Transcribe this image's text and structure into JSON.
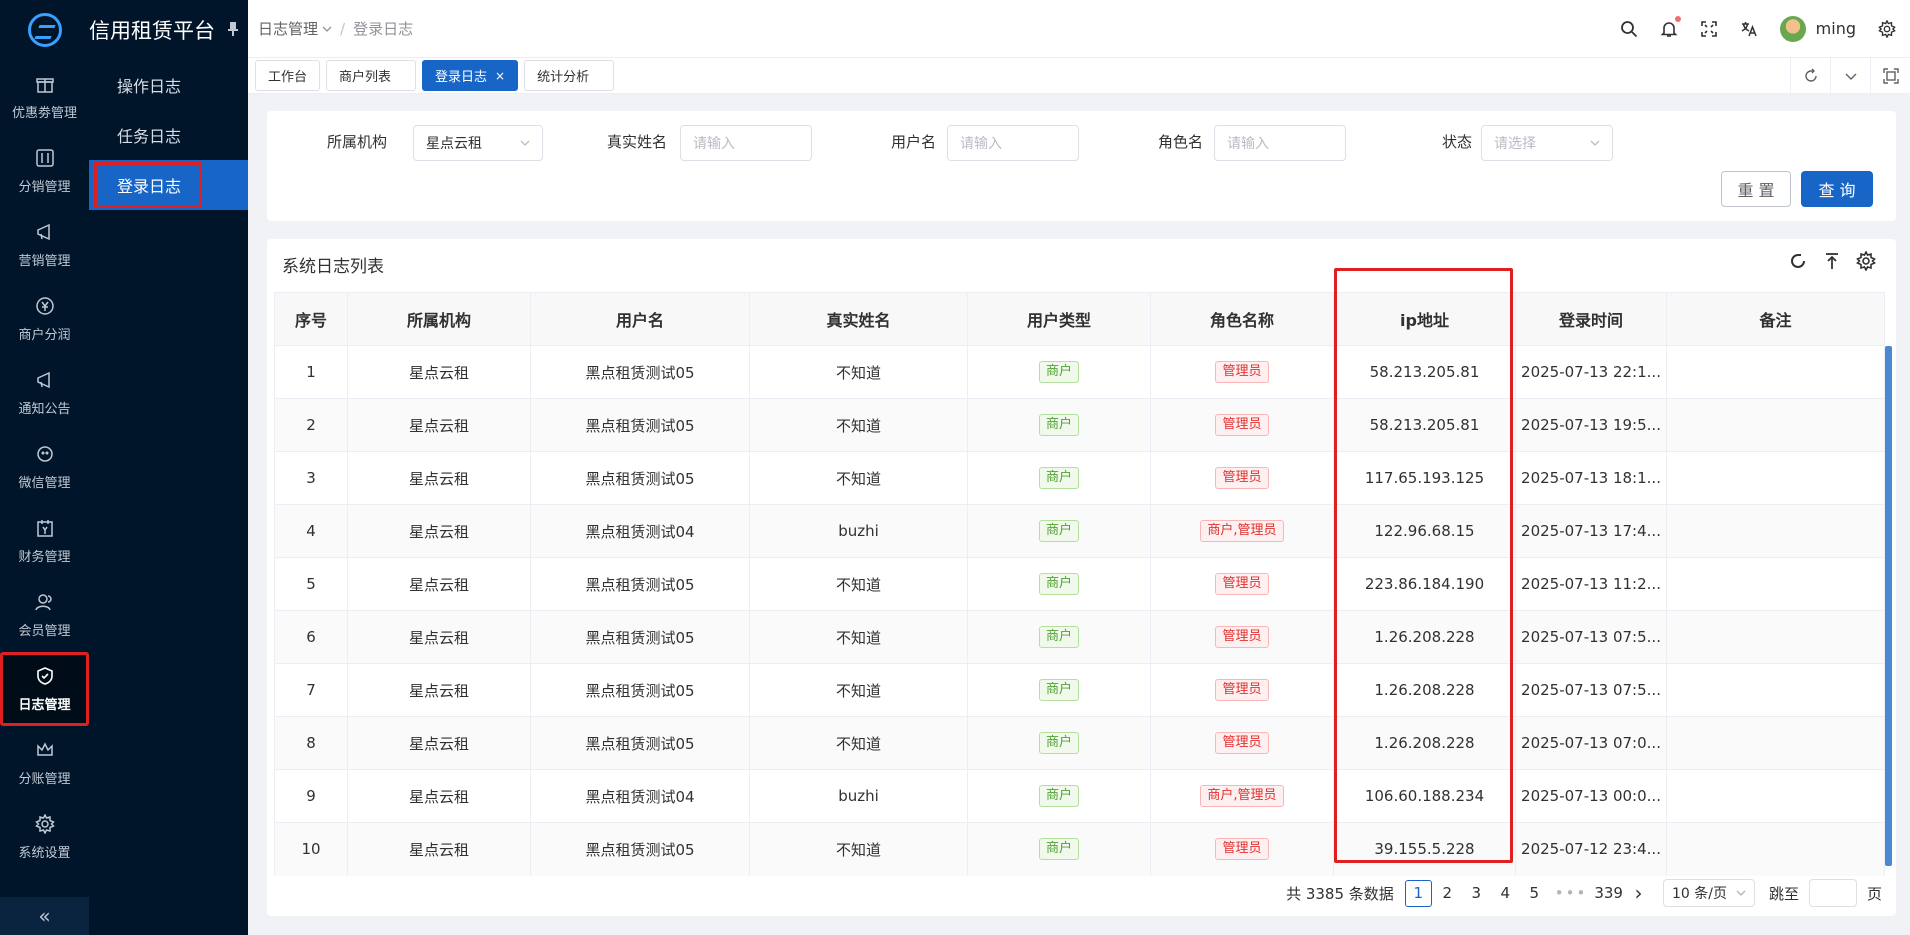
{
  "app": {
    "title": "信用租赁平台"
  },
  "rail": {
    "items": [
      {
        "label": "优惠劵管理",
        "icon": "gift-icon"
      },
      {
        "label": "分销管理",
        "icon": "sliders-icon"
      },
      {
        "label": "营销管理",
        "icon": "megaphone-icon"
      },
      {
        "label": "商户分润",
        "icon": "yen-circle-icon"
      },
      {
        "label": "通知公告",
        "icon": "megaphone-icon"
      },
      {
        "label": "微信管理",
        "icon": "wechat-icon"
      },
      {
        "label": "财务管理",
        "icon": "calendar-yen-icon"
      },
      {
        "label": "会员管理",
        "icon": "users-icon"
      },
      {
        "label": "日志管理",
        "icon": "shield-check-icon"
      },
      {
        "label": "分账管理",
        "icon": "crown-icon"
      },
      {
        "label": "系统设置",
        "icon": "gear-icon"
      }
    ],
    "collapse": "«"
  },
  "submenu": {
    "items": [
      "操作日志",
      "任务日志",
      "登录日志"
    ]
  },
  "header": {
    "breadcrumb": [
      "日志管理",
      "登录日志"
    ],
    "user": "ming"
  },
  "tabs": [
    {
      "label": "工作台"
    },
    {
      "label": "商户列表"
    },
    {
      "label": "登录日志",
      "close": "×"
    },
    {
      "label": "统计分析"
    }
  ],
  "filter": {
    "org_label": "所属机构",
    "org_value": "星点云租",
    "realname_label": "真实姓名",
    "realname_placeholder": "请输入",
    "username_label": "用户名",
    "username_placeholder": "请输入",
    "role_label": "角色名",
    "role_placeholder": "请输入",
    "status_label": "状态",
    "status_placeholder": "请选择",
    "reset": "重 置",
    "query": "查 询"
  },
  "table": {
    "title": "系统日志列表",
    "columns": [
      "序号",
      "所属机构",
      "用户名",
      "真实姓名",
      "用户类型",
      "角色名称",
      "ip地址",
      "登录时间",
      "备注"
    ],
    "rows": [
      {
        "no": "1",
        "org": "星点云租",
        "user": "黑点租赁测试05",
        "real": "不知道",
        "type": "商户",
        "role": "管理员",
        "ip": "58.213.205.81",
        "time": "2025-07-13 22:1...",
        "note": ""
      },
      {
        "no": "2",
        "org": "星点云租",
        "user": "黑点租赁测试05",
        "real": "不知道",
        "type": "商户",
        "role": "管理员",
        "ip": "58.213.205.81",
        "time": "2025-07-13 19:5...",
        "note": ""
      },
      {
        "no": "3",
        "org": "星点云租",
        "user": "黑点租赁测试05",
        "real": "不知道",
        "type": "商户",
        "role": "管理员",
        "ip": "117.65.193.125",
        "time": "2025-07-13 18:1...",
        "note": ""
      },
      {
        "no": "4",
        "org": "星点云租",
        "user": "黑点租赁测试04",
        "real": "buzhi",
        "type": "商户",
        "role": "商户,管理员",
        "ip": "122.96.68.15",
        "time": "2025-07-13 17:4...",
        "note": ""
      },
      {
        "no": "5",
        "org": "星点云租",
        "user": "黑点租赁测试05",
        "real": "不知道",
        "type": "商户",
        "role": "管理员",
        "ip": "223.86.184.190",
        "time": "2025-07-13 11:2...",
        "note": ""
      },
      {
        "no": "6",
        "org": "星点云租",
        "user": "黑点租赁测试05",
        "real": "不知道",
        "type": "商户",
        "role": "管理员",
        "ip": "1.26.208.228",
        "time": "2025-07-13 07:5...",
        "note": ""
      },
      {
        "no": "7",
        "org": "星点云租",
        "user": "黑点租赁测试05",
        "real": "不知道",
        "type": "商户",
        "role": "管理员",
        "ip": "1.26.208.228",
        "time": "2025-07-13 07:5...",
        "note": ""
      },
      {
        "no": "8",
        "org": "星点云租",
        "user": "黑点租赁测试05",
        "real": "不知道",
        "type": "商户",
        "role": "管理员",
        "ip": "1.26.208.228",
        "time": "2025-07-13 07:0...",
        "note": ""
      },
      {
        "no": "9",
        "org": "星点云租",
        "user": "黑点租赁测试04",
        "real": "buzhi",
        "type": "商户",
        "role": "商户,管理员",
        "ip": "106.60.188.234",
        "time": "2025-07-13 00:0...",
        "note": ""
      },
      {
        "no": "10",
        "org": "星点云租",
        "user": "黑点租赁测试05",
        "real": "不知道",
        "type": "商户",
        "role": "管理员",
        "ip": "39.155.5.228",
        "time": "2025-07-12 23:4...",
        "note": ""
      }
    ]
  },
  "pagination": {
    "total": "共 3385 条数据",
    "pages": [
      "1",
      "2",
      "3",
      "4",
      "5"
    ],
    "more": "•••",
    "last": "339",
    "next": "›",
    "size": "10 条/页",
    "jump": "跳至",
    "page_unit": "页"
  },
  "colors": {
    "primary": "#1766c7",
    "sidebar": "#001529",
    "highlight": "#e02020"
  }
}
